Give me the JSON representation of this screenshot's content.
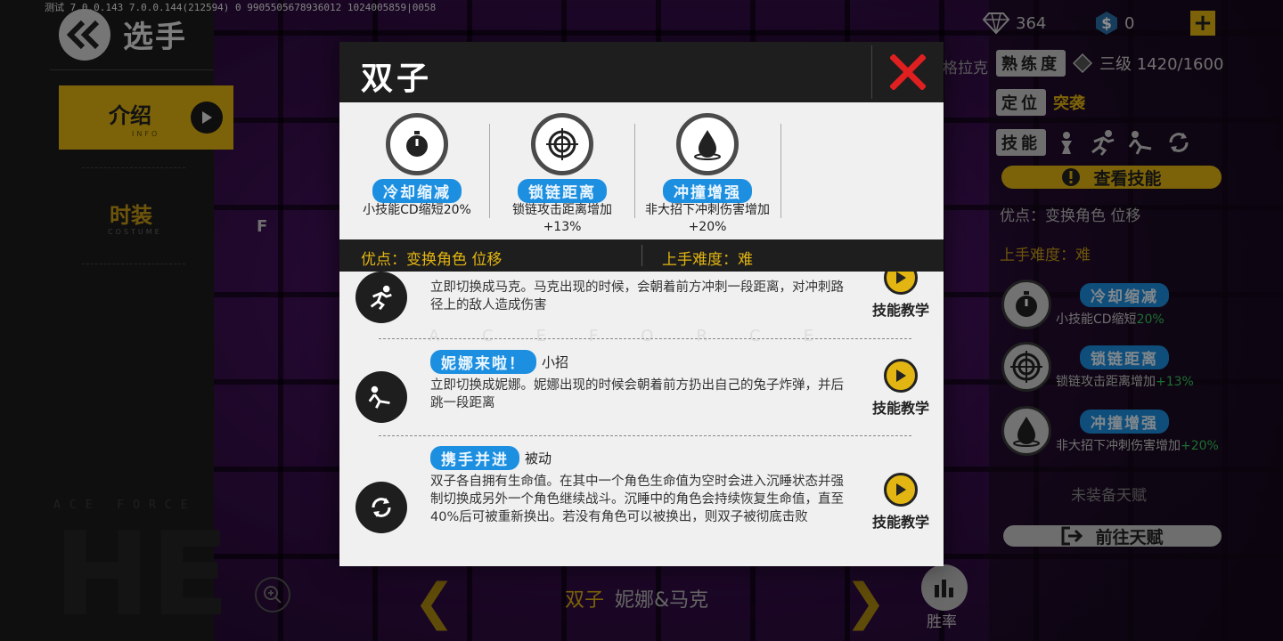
{
  "debug_text": "测试 7.0.0.143 7.0.0.144(212594) 0 9905505678936012 1024005859|0058",
  "page_title": "选手",
  "nav": {
    "info_label": "介绍",
    "info_sub": "INFO",
    "costume_label": "时装",
    "costume_sub": "COSTUME"
  },
  "left_deco": {
    "line": "ACE FORCE",
    "big": "HE"
  },
  "letter_f": "F",
  "currency": {
    "diamond": "364",
    "coin": "0",
    "plus": "+"
  },
  "side_name": "格拉克",
  "stats": {
    "mastery_tag": "熟练度",
    "mastery_value": "三级 1420/1600",
    "role_tag": "定位",
    "role_value": "突袭",
    "skill_tag": "技能"
  },
  "view_skill_label": "查看技能",
  "advantage_text": "优点：变换角色  位移",
  "difficulty_text": "上手难度：难",
  "talents": [
    {
      "name": "冷却缩减",
      "desc": "小技能CD缩短",
      "bonus": "20%",
      "icon": "stopwatch-icon"
    },
    {
      "name": "锁链距离",
      "desc": "锁链攻击距离增加",
      "bonus": "+13%",
      "icon": "crosshair-icon"
    },
    {
      "name": "冲撞增强",
      "desc": "非大招下冲刺伤害增加",
      "bonus": "+20%",
      "icon": "water-drop-icon"
    }
  ],
  "no_talent_text": "未装备天赋",
  "goto_talent_label": "前往天赋",
  "bottom": {
    "hero_tag": "双子",
    "hero_name": "妮娜&马克",
    "winrate_label": "胜率",
    "left_arrow": "❮",
    "right_arrow": "❯"
  },
  "modal": {
    "title": "双子",
    "features": [
      {
        "name": "冷却缩减",
        "desc": "小技能CD缩短20%"
      },
      {
        "name": "锁链距离",
        "desc": "锁链攻击距离增加+13%"
      },
      {
        "name": "冲撞增强",
        "desc": "非大招下冲刺伤害增加+20%"
      }
    ],
    "advantage": "优点：变换角色  位移",
    "difficulty": "上手难度：难",
    "watermark": "ACEFORCE",
    "skills": [
      {
        "name": "",
        "kind": "",
        "text": "立即切换成马克。马克出现的时候，会朝着前方冲刺一段距离，对冲刺路径上的敌人造成伤害",
        "icon": "sprint-icon"
      },
      {
        "name": "妮娜来啦！",
        "kind": "小招",
        "text": "立即切换成妮娜。妮娜出现的时候会朝着前方扔出自己的兔子炸弹，并后跳一段距离",
        "icon": "throw-icon"
      },
      {
        "name": "携手并进",
        "kind": "被动",
        "text": "双子各自拥有生命值。在其中一个角色生命值为空时会进入沉睡状态并强制切换成另外一个角色继续战斗。沉睡中的角色会持续恢复生命值，直至40%后可被重新换出。若没有角色可以被换出，则双子被彻底击败",
        "icon": "swap-icon"
      }
    ],
    "tutorial_label": "技能教学"
  },
  "colors": {
    "accent": "#e2b512",
    "pill": "#1d8fe0",
    "close": "#e02020",
    "bonus": "#36c85a"
  }
}
